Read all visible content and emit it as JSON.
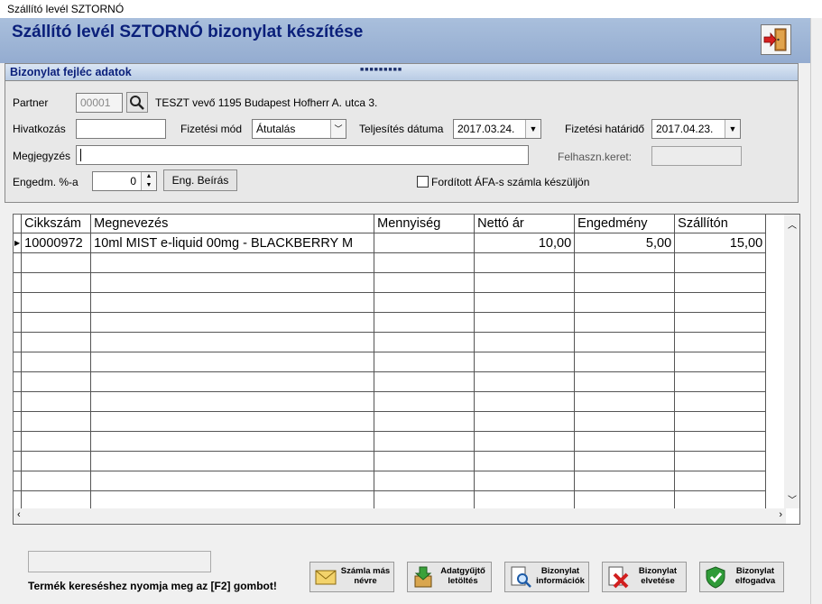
{
  "window": {
    "title": "Szállító levél SZTORNÓ"
  },
  "header": {
    "title": "Szállító levél SZTORNÓ bizonylat készítése"
  },
  "section": {
    "title": "Bizonylat fejléc adatok"
  },
  "form": {
    "partner_label": "Partner",
    "partner_code": "00001",
    "partner_name": "TESZT vevő 1195 Budapest Hofherr A. utca 3.",
    "hivatkozas_label": "Hivatkozás",
    "hivatkozas_value": "",
    "fizetesi_mod_label": "Fizetési mód",
    "fizetesi_mod_value": "Átutalás",
    "teljesites_label": "Teljesítés dátuma",
    "teljesites_value": "2017.03.24.",
    "hatarido_label": "Fizetési határidő",
    "hatarido_value": "2017.04.23.",
    "megjegyzes_label": "Megjegyzés",
    "megjegyzes_value": "",
    "keret_label": "Felhaszn.keret:",
    "engedm_label": "Engedm. %-a",
    "engedm_value": "0",
    "eng_beiras_label": "Eng. Beírás",
    "forditott_label": "Fordított ÁFA-s számla készüljön"
  },
  "grid": {
    "columns": [
      "Cikkszám",
      "Megnevezés",
      "Mennyiség",
      "Nettó ár",
      "Engedmény",
      "Szállítón"
    ],
    "rows": [
      [
        "10000972",
        "10ml MIST e-liquid 00mg - BLACKBERRY M",
        "",
        "10,00",
        "5,00",
        "15,00"
      ]
    ]
  },
  "footer": {
    "hint": "Termék kereséshez nyomja meg az [F2] gombot!",
    "buttons": [
      {
        "label": "Számla más névre"
      },
      {
        "label": "Adatgyűjtő letöltés"
      },
      {
        "label": "Bizonylat információk"
      },
      {
        "label": "Bizonylat elvetése"
      },
      {
        "label": "Bizonylat elfogadva"
      }
    ]
  }
}
